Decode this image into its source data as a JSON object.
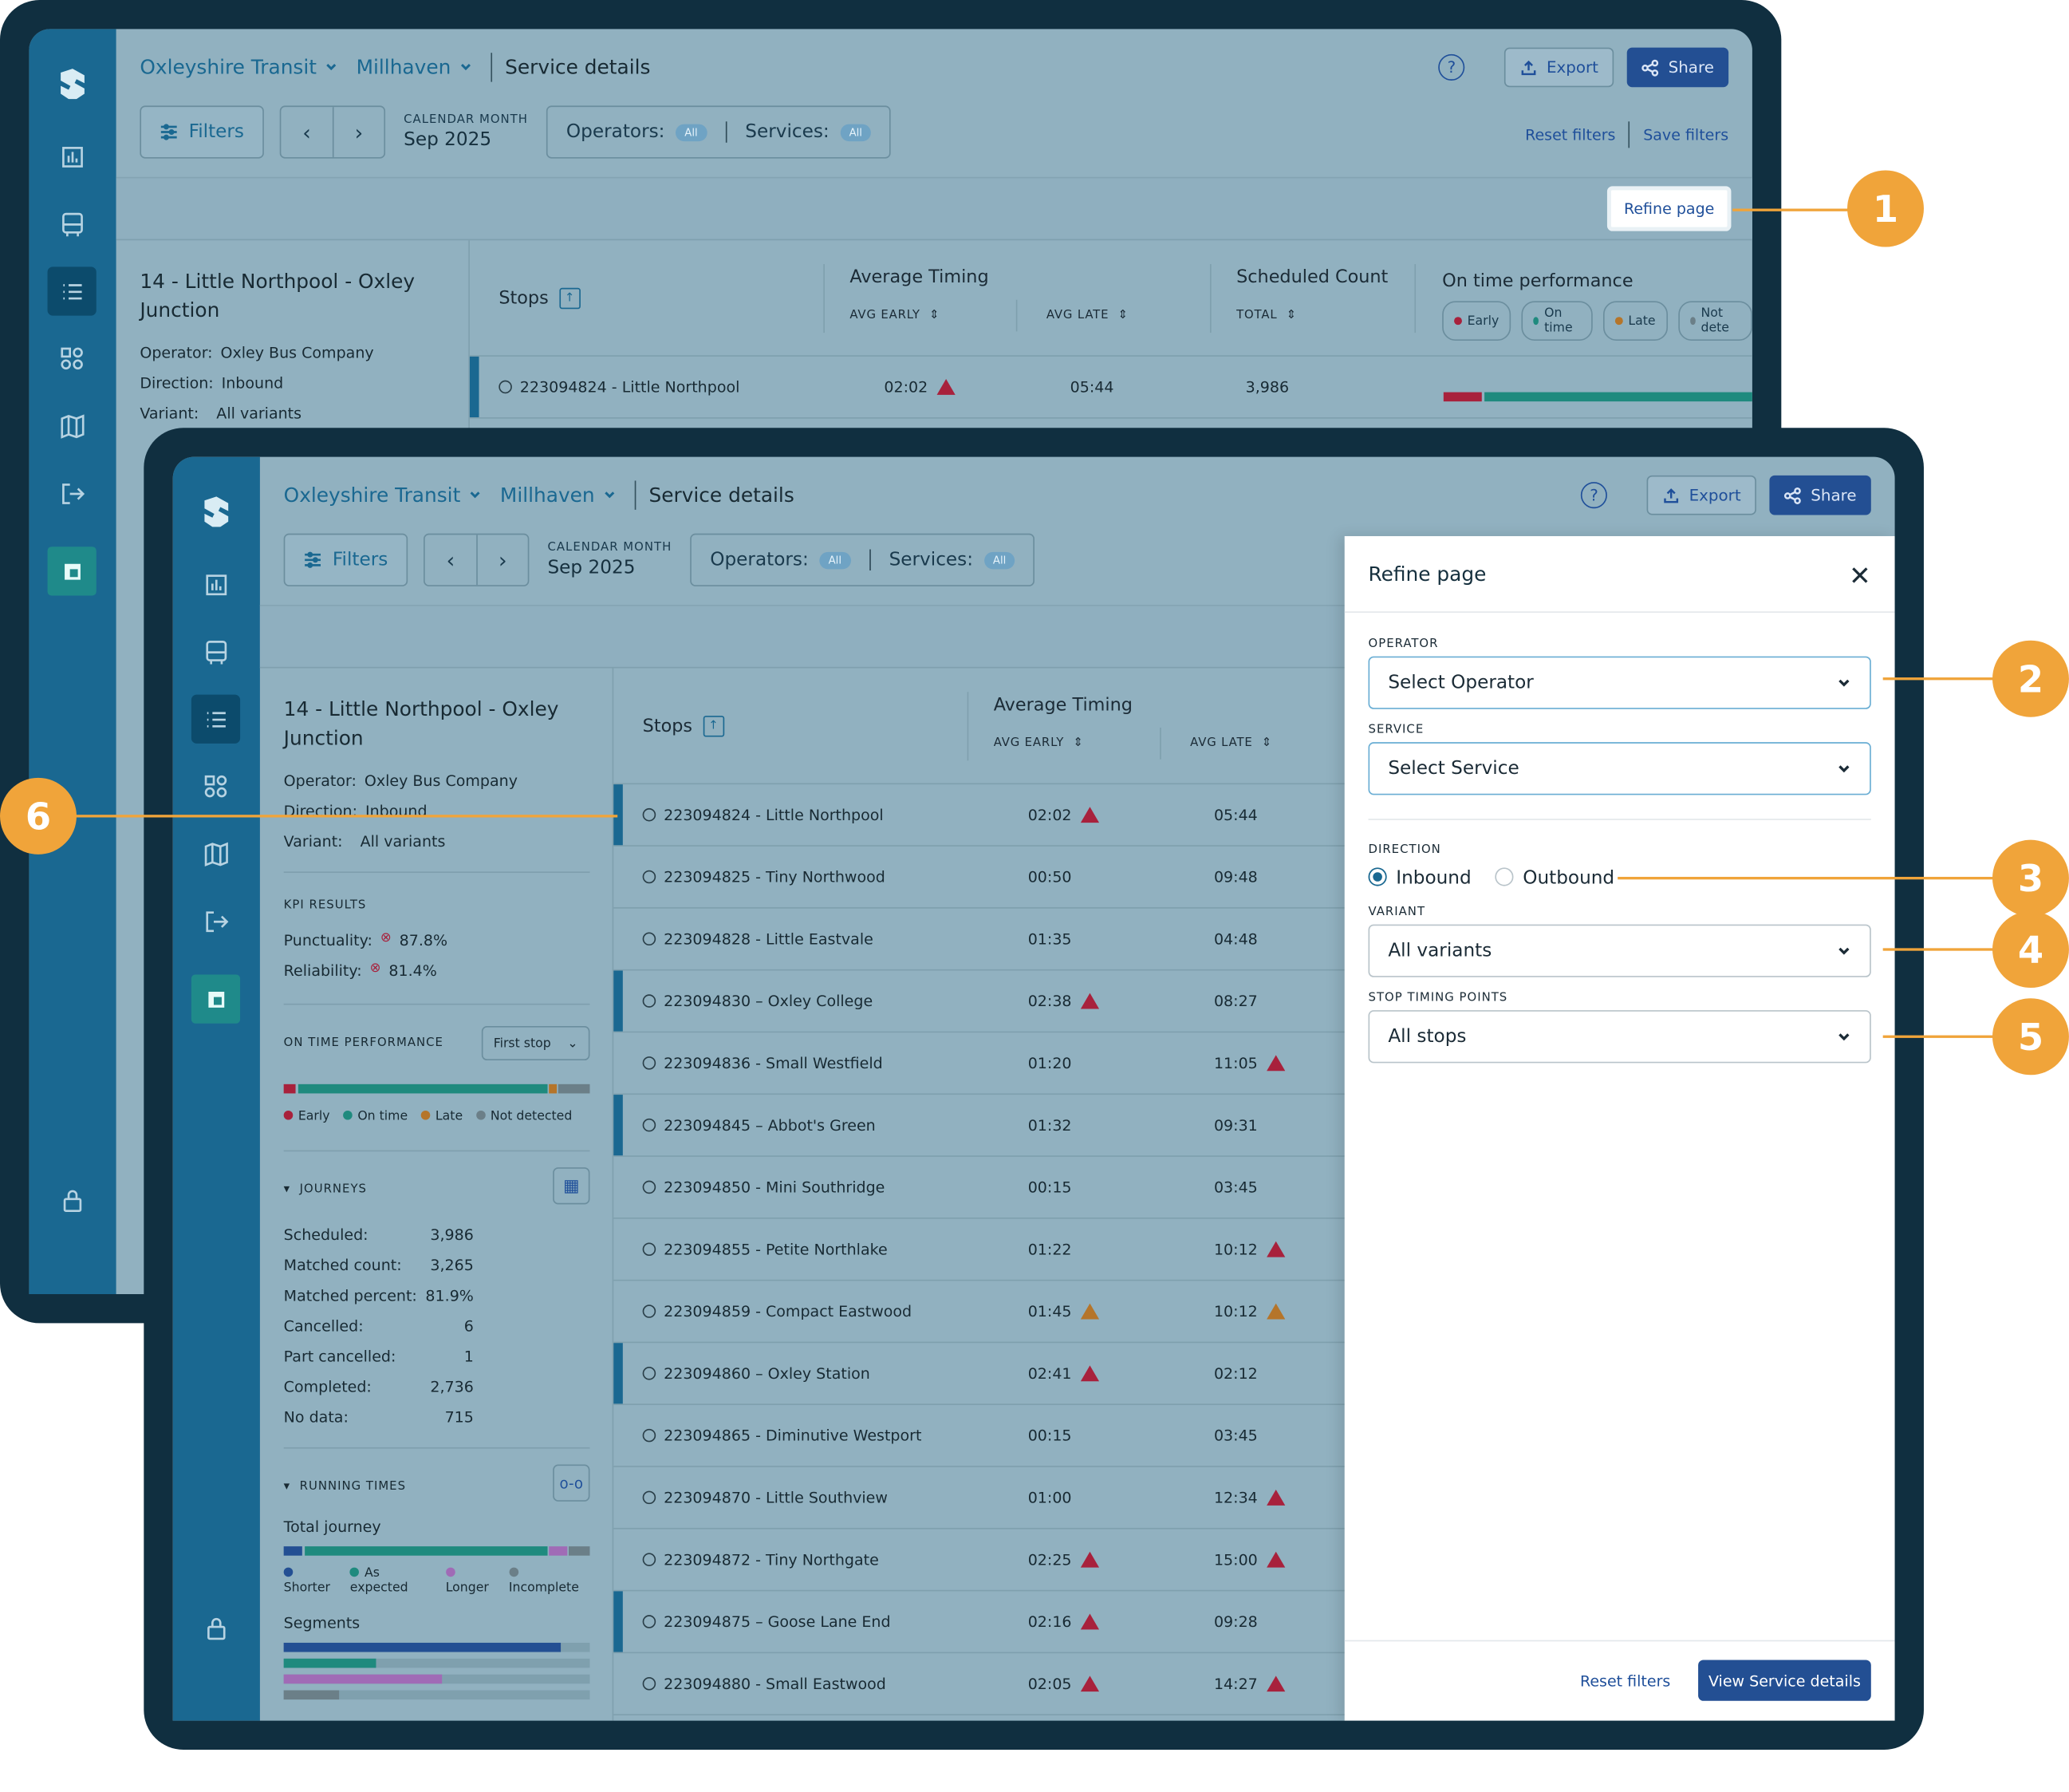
{
  "crumbs": {
    "org": "Oxleyshire Transit",
    "area": "Millhaven",
    "page": "Service details"
  },
  "header": {
    "help": "?",
    "export": "Export",
    "share": "Share"
  },
  "filters": {
    "filters_label": "Filters",
    "cal_label": "CALENDAR MONTH",
    "cal_value": "Sep 2025",
    "operators_label": "Operators:",
    "services_label": "Services:",
    "all": "All",
    "reset": "Reset filters",
    "save": "Save filters"
  },
  "refine_button": "Refine page",
  "service": {
    "title": "14 - Little Northpool - Oxley Junction",
    "operator_k": "Operator:",
    "operator_v": "Oxley Bus Company",
    "direction_k": "Direction:",
    "direction_v": "Inbound",
    "variant_k": "Variant:",
    "variant_v": "All variants"
  },
  "kpi": {
    "title": "KPI RESULTS",
    "punct_k": "Punctuality:",
    "punct_v": "87.8%",
    "rel_k": "Reliability:",
    "rel_v": "81.4%"
  },
  "otp": {
    "title": "ON TIME PERFORMANCE",
    "select": "First stop",
    "early": "Early",
    "ontime": "On time",
    "late": "Late",
    "notdet": "Not detected",
    "notdet_short": "Not dete"
  },
  "journeys": {
    "title": "JOURNEYS",
    "rows": [
      [
        "Scheduled:",
        "3,986"
      ],
      [
        "Matched count:",
        "3,265"
      ],
      [
        "Matched percent:",
        "81.9%"
      ],
      [
        "Cancelled:",
        "6"
      ],
      [
        "Part cancelled:",
        "1"
      ],
      [
        "Completed:",
        "2,736"
      ],
      [
        "No data:",
        "715"
      ]
    ]
  },
  "running": {
    "title": "RUNNING TIMES",
    "total": "Total journey",
    "shorter": "Shorter",
    "expected": "As expected",
    "longer": "Longer",
    "incomplete": "Incomplete",
    "segments": "Segments"
  },
  "table": {
    "stops": "Stops",
    "avg_timing": "Average Timing",
    "avg_early": "AVG EARLY",
    "avg_late": "AVG LATE",
    "sched_count": "Scheduled Count",
    "total": "TOTAL",
    "otp": "On time performance",
    "back_row": {
      "stop": "223094824 - Little Northpool",
      "early": "02:02",
      "late": "05:44",
      "count": "3,986"
    },
    "rows": [
      {
        "stop": "223094824 - Little Northpool",
        "early": "02:02",
        "ew": "red",
        "late": "05:44",
        "lw": "",
        "bar": true
      },
      {
        "stop": "223094825 - Tiny Northwood",
        "early": "00:50",
        "ew": "",
        "late": "09:48",
        "lw": "",
        "bar": false
      },
      {
        "stop": "223094828 - Little Eastvale",
        "early": "01:35",
        "ew": "",
        "late": "04:48",
        "lw": "",
        "bar": false
      },
      {
        "stop": "223094830 – Oxley College",
        "early": "02:38",
        "ew": "red",
        "late": "08:27",
        "lw": "",
        "bar": true
      },
      {
        "stop": "223094836 - Small Westfield",
        "early": "01:20",
        "ew": "",
        "late": "11:05",
        "lw": "red",
        "bar": false
      },
      {
        "stop": "223094845 – Abbot's Green",
        "early": "01:32",
        "ew": "",
        "late": "09:31",
        "lw": "",
        "bar": true
      },
      {
        "stop": "223094850 - Mini Southridge",
        "early": "00:15",
        "ew": "",
        "late": "03:45",
        "lw": "",
        "bar": false
      },
      {
        "stop": "223094855 - Petite Northlake",
        "early": "01:22",
        "ew": "",
        "late": "10:12",
        "lw": "red",
        "bar": false
      },
      {
        "stop": "223094859 - Compact Eastwood",
        "early": "01:45",
        "ew": "orange",
        "late": "10:12",
        "lw": "orange",
        "bar": false
      },
      {
        "stop": "223094860 – Oxley Station",
        "early": "02:41",
        "ew": "red",
        "late": "02:12",
        "lw": "",
        "bar": true
      },
      {
        "stop": "223094865 - Diminutive Westport",
        "early": "00:15",
        "ew": "",
        "late": "03:45",
        "lw": "",
        "bar": false
      },
      {
        "stop": "223094870 - Little Southview",
        "early": "01:00",
        "ew": "",
        "late": "12:34",
        "lw": "red",
        "bar": false
      },
      {
        "stop": "223094872 - Tiny Northgate",
        "early": "02:25",
        "ew": "red",
        "late": "15:00",
        "lw": "red",
        "bar": false
      },
      {
        "stop": "223094875 – Goose Lane End",
        "early": "02:16",
        "ew": "red",
        "late": "09:28",
        "lw": "",
        "bar": true
      },
      {
        "stop": "223094880 - Small Eastwood",
        "early": "02:05",
        "ew": "red",
        "late": "14:27",
        "lw": "red",
        "bar": false
      }
    ]
  },
  "panel": {
    "title": "Refine page",
    "operator_l": "OPERATOR",
    "operator_v": "Select Operator",
    "service_l": "SERVICE",
    "service_v": "Select Service",
    "direction_l": "DIRECTION",
    "inbound": "Inbound",
    "outbound": "Outbound",
    "variant_l": "VARIANT",
    "variant_v": "All variants",
    "stp_l": "STOP TIMING POINTS",
    "stp_v": "All stops",
    "reset": "Reset filters",
    "view": "View Service details"
  },
  "callouts": [
    "1",
    "2",
    "3",
    "4",
    "5",
    "6"
  ],
  "colors": {
    "accent": "#1a6891",
    "callout": "#f0a43a",
    "early": "#a8213c",
    "ontime": "#1f8a7e",
    "late": "#b5752a",
    "notdet": "#6b7f88"
  }
}
